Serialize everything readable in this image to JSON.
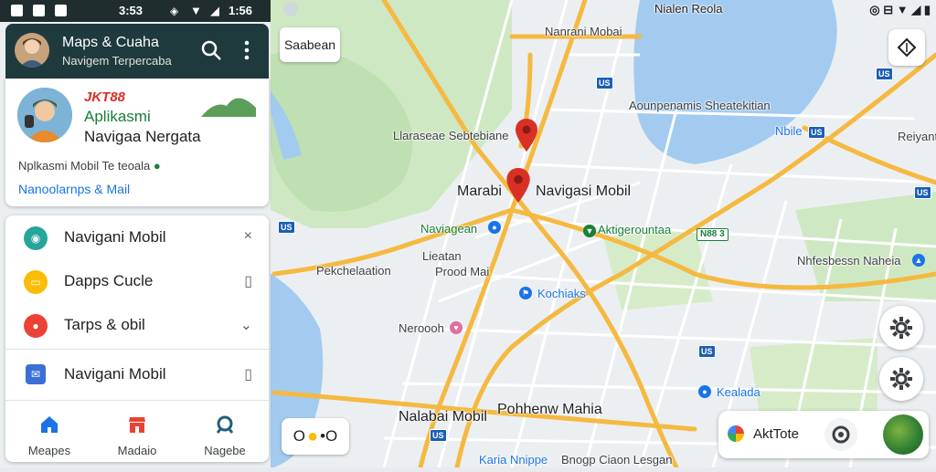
{
  "status_bar": {
    "left_time": "3:53",
    "right_time": "1:56",
    "right_network": "Nialen Reola"
  },
  "header": {
    "title": "Maps & Cuaha",
    "subtitle": "Navigem Terpercaba"
  },
  "promo": {
    "brand": "JKT88",
    "line1": "Aplikasmi",
    "line2": "Navigaa Nergata",
    "description": "Nplkasmi Mobil Te teoala",
    "link": "Nanoolarnps & Mail"
  },
  "menu": {
    "items": [
      {
        "label": "Navigani Mobil",
        "trail": "×",
        "color": "#26a69a"
      },
      {
        "label": "Dapps Cucle",
        "trail": "▯",
        "color": "#fbbc04"
      },
      {
        "label": "Tarps & obil",
        "trail": "⌄",
        "color": "#ea4335"
      },
      {
        "label": "Navigani Mobil",
        "trail": "▯",
        "color": "#3b6fd6"
      }
    ],
    "nav": [
      {
        "label": "Meapes"
      },
      {
        "label": "Madaio"
      },
      {
        "label": "Nagebe"
      }
    ]
  },
  "map": {
    "search_chip": "Saabean",
    "toggle": "O ●•O",
    "route_label": "AktTote",
    "labels": {
      "top": "Nanrani Mobai",
      "lake": "Aounpenamis Sheatekitian",
      "lake_small": "Nbile",
      "right_top": "Reiyant",
      "pin_top": "Llaraseae Sebtebiane",
      "center_left": "Marabi",
      "center_right": "Navigasi Mobil",
      "green_left": "Naviagean",
      "green_right": "Aktigerountaa",
      "shield_green": "N88 3",
      "left_mid": "Lieatan",
      "left_mid2": "Pekchelaation",
      "prood": "Prood Mai",
      "kochiaks": "Kochiaks",
      "right_mid": "Nhfesbessn Naheia",
      "neroooh": "Neroooh",
      "bottom_left": "Nalabai Mobil",
      "bottom_mid": "Pohhenw Mahia",
      "kealada": "Kealada",
      "bottom_edge": "Karia Nnippe",
      "bottom_edge2": "Bnogp Ciaon Lesgan"
    }
  }
}
